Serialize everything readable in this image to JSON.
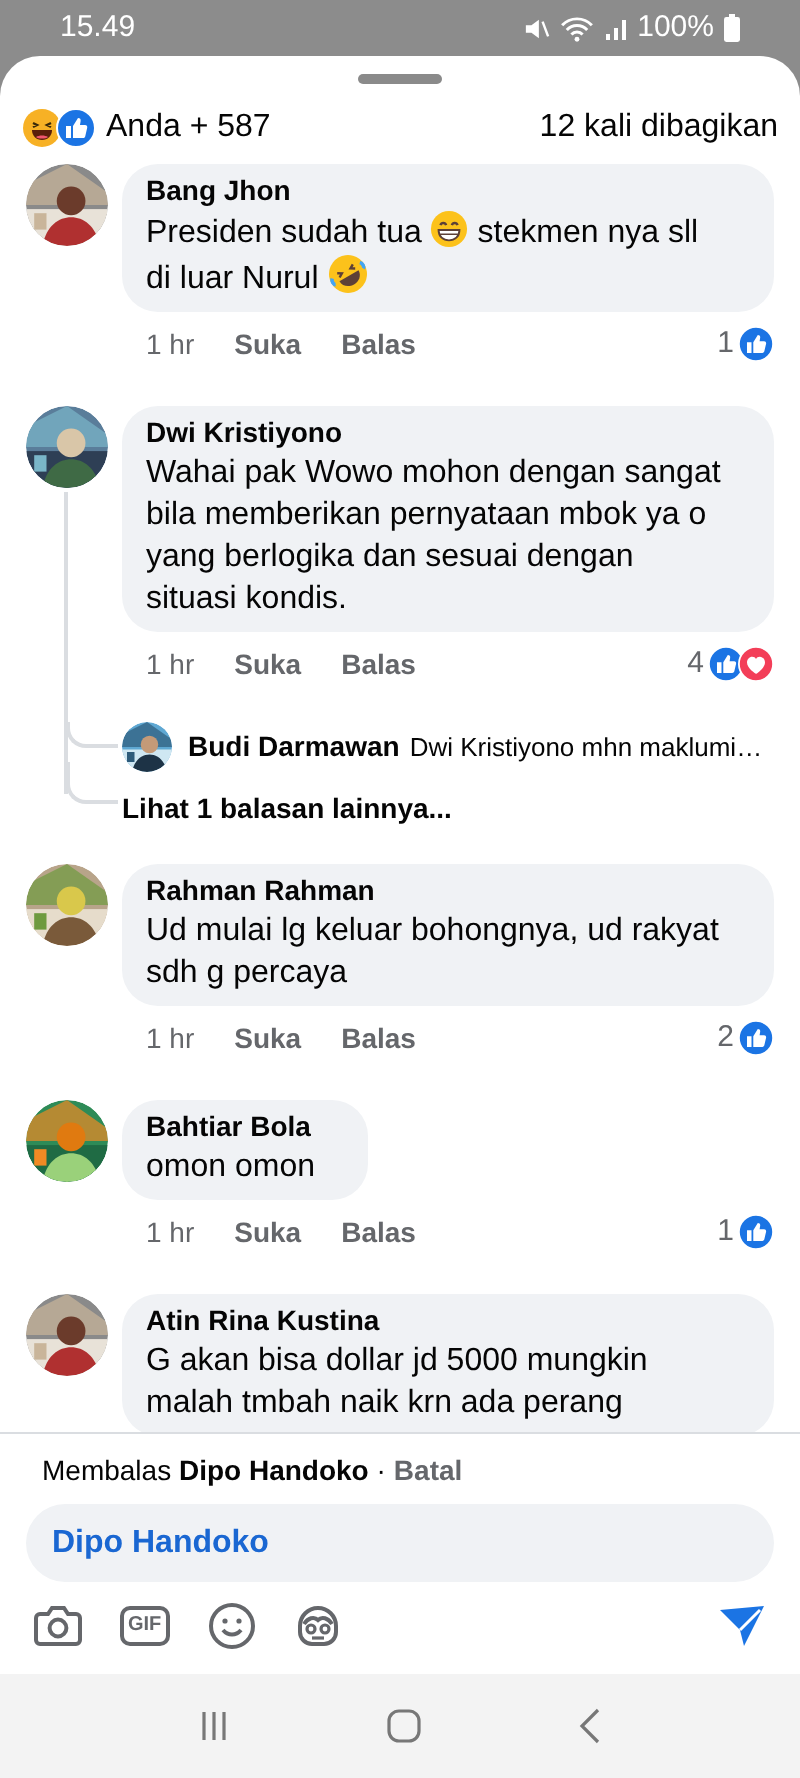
{
  "status_bar": {
    "time": "15.49",
    "battery": "100%"
  },
  "header": {
    "reactions": [
      {
        "kind": "haha"
      },
      {
        "kind": "like"
      }
    ],
    "reacted_by": "Anda + 587",
    "shares": "12 kali dibagikan"
  },
  "comments": [
    {
      "name": "Bang Jhon",
      "avatar": {
        "kind": "picture"
      },
      "segments": [
        {
          "kind": "text",
          "text": "Presiden sudah tua"
        },
        {
          "kind": "grin"
        },
        {
          "kind": "text",
          "text": "stekmen nya sll"
        },
        {
          "kind": "text",
          "text": "di luar Nurul"
        },
        {
          "kind": "rofl"
        }
      ],
      "time": "1 hr",
      "like": "Suka",
      "reply": "Balas",
      "count": "1",
      "reactions": [
        {
          "kind": "like"
        }
      ]
    },
    {
      "name": "Dwi Kristiyono",
      "avatar": {
        "kind": "picture"
      },
      "segments": [
        {
          "kind": "text",
          "text": "Wahai pak Wowo mohon dengan sangat bila memberikan pernyataan mbok ya o yang berlogika dan sesuai dengan situasi kondis."
        }
      ],
      "time": "1 hr",
      "like": "Suka",
      "reply": "Balas",
      "count": "4",
      "reactions": [
        {
          "kind": "like"
        },
        {
          "kind": "love"
        }
      ],
      "replies": [
        {
          "name": "Budi Darmawan",
          "avatar": {
            "kind": "picture"
          },
          "text": "Dwi Kristiyono mhn maklumi…"
        }
      ],
      "more_replies": "Lihat 1 balasan lainnya..."
    },
    {
      "name": "Rahman Rahman",
      "avatar": {
        "kind": "picture"
      },
      "segments": [
        {
          "kind": "text",
          "text": "Ud mulai lg keluar bohongnya, ud rakyat sdh g percaya"
        }
      ],
      "time": "1 hr",
      "like": "Suka",
      "reply": "Balas",
      "count": "2",
      "reactions": [
        {
          "kind": "like"
        }
      ]
    },
    {
      "name": "Bahtiar Bola",
      "avatar": {
        "kind": "picture"
      },
      "segments": [
        {
          "kind": "text",
          "text": "omon omon"
        }
      ],
      "time": "1 hr",
      "like": "Suka",
      "reply": "Balas",
      "count": "1",
      "reactions": [
        {
          "kind": "like"
        }
      ]
    },
    {
      "name": "Atin Rina Kustina",
      "avatar": {
        "kind": "picture"
      },
      "segments": [
        {
          "kind": "text",
          "text": "G akan bisa dollar jd 5000 mungkin malah tmbah naik krn ada perang"
        }
      ]
    }
  ],
  "reply_bar": {
    "prefix": "Membalas",
    "target": "Dipo Handoko",
    "separator": "·",
    "cancel": "Batal",
    "value": "Dipo Handoko",
    "gif_label": "GIF"
  }
}
